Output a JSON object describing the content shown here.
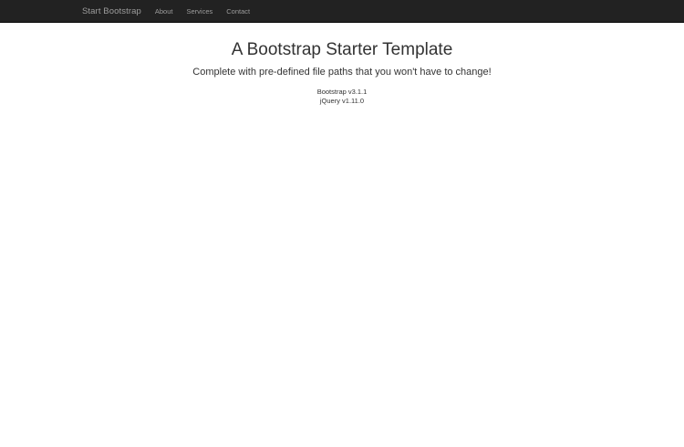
{
  "navbar": {
    "brand": "Start Bootstrap",
    "links": [
      "About",
      "Services",
      "Contact"
    ]
  },
  "main": {
    "title": "A Bootstrap Starter Template",
    "subtitle": "Complete with pre-defined file paths that you won't have to change!",
    "versions": [
      "Bootstrap v3.1.1",
      "jQuery v1.11.0"
    ]
  },
  "colors": {
    "navbar_bg": "#222222",
    "nav_text": "#9d9d9d",
    "body_text": "#333333"
  }
}
